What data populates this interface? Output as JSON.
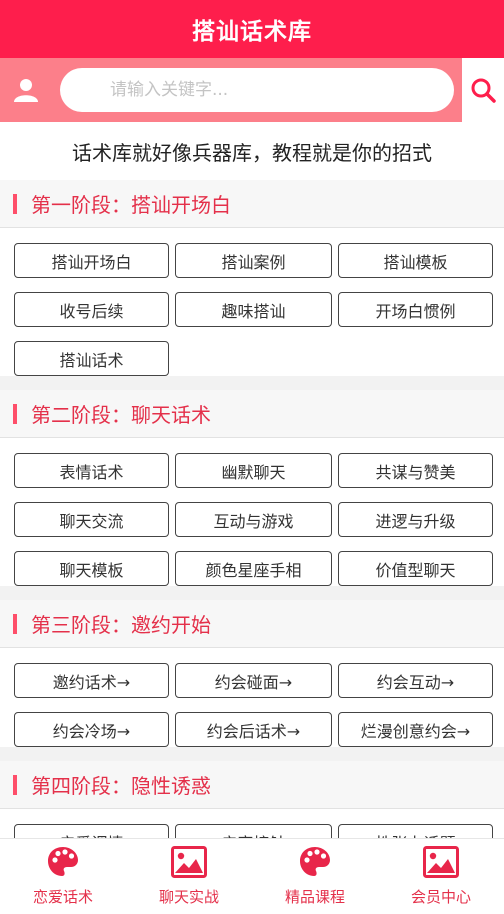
{
  "header": {
    "title": "搭讪话术库"
  },
  "search": {
    "placeholder": "请输入关键字..."
  },
  "tagline": "话术库就好像兵器库，教程就是你的招式",
  "sections": [
    {
      "title": "第一阶段：搭讪开场白",
      "items": [
        "搭讪开场白",
        "搭讪案例",
        "搭讪模板",
        "收号后续",
        "趣味搭讪",
        "开场白惯例",
        "搭讪话术"
      ]
    },
    {
      "title": "第二阶段：聊天话术",
      "items": [
        "表情话术",
        "幽默聊天",
        "共谋与赞美",
        "聊天交流",
        "互动与游戏",
        "进逻与升级",
        "聊天模板",
        "颜色星座手相",
        "价值型聊天"
      ]
    },
    {
      "title": "第三阶段：邀约开始",
      "items": [
        "邀约话术→",
        "约会碰面→",
        "约会互动→",
        "约会冷场→",
        "约会后话术→",
        "烂漫创意约会→"
      ]
    },
    {
      "title": "第四阶段：隐性诱惑",
      "items": [
        "亲爱调情",
        "亲密接触",
        "性张力话题"
      ]
    }
  ],
  "tabbar": {
    "items": [
      {
        "label": "恋爱话术",
        "icon": "palette-icon"
      },
      {
        "label": "聊天实战",
        "icon": "image-icon"
      },
      {
        "label": "精品课程",
        "icon": "palette-icon"
      },
      {
        "label": "会员中心",
        "icon": "image-icon"
      }
    ]
  },
  "colors": {
    "primary": "#fe1e4c",
    "search_bar": "#fc7f8a",
    "accent_text": "#e4304a"
  }
}
